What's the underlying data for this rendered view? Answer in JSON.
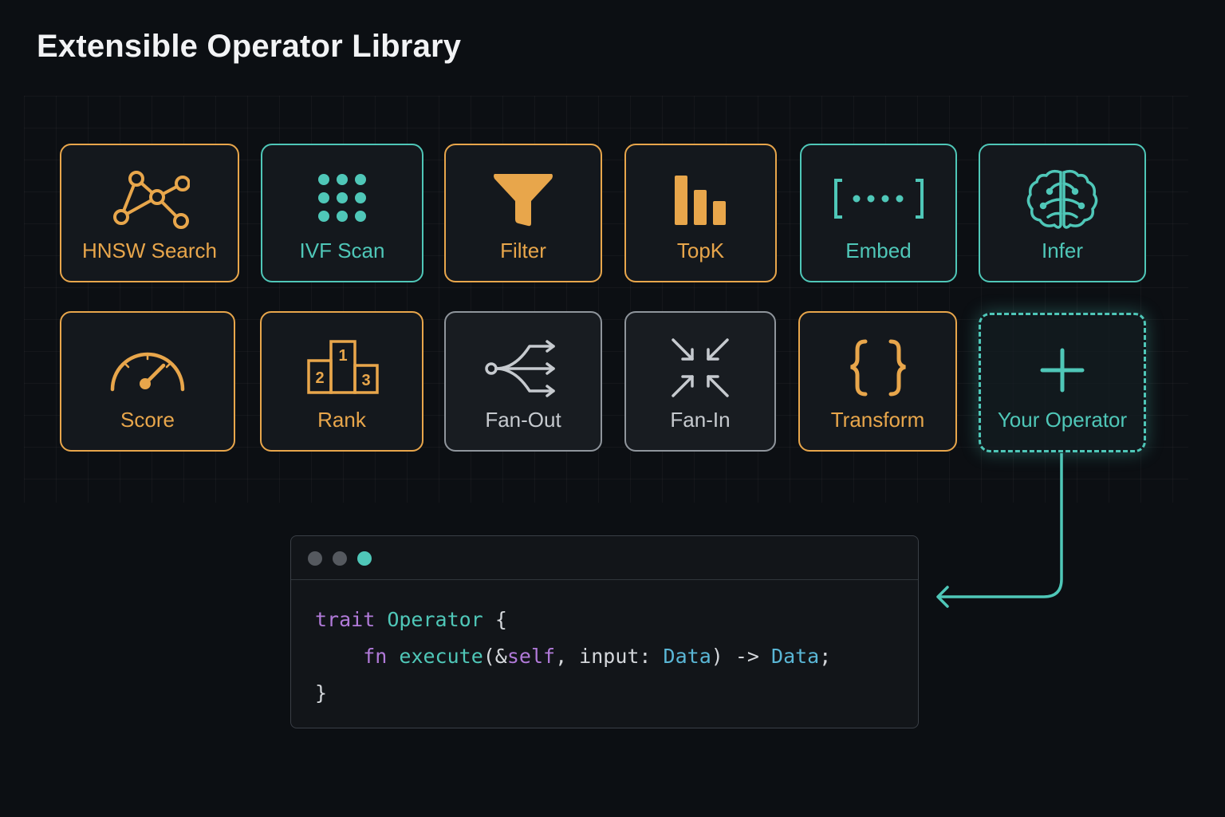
{
  "title": "Extensible Operator Library",
  "colors": {
    "orange": "#e8a64b",
    "teal": "#4fc7b8",
    "gray": "#8f959c",
    "keyword_purple": "#b17ad9",
    "type_blue": "#5ab7d6",
    "background": "#0c0f13"
  },
  "operators": [
    {
      "label": "HNSW Search",
      "icon": "graph-icon",
      "color": "orange"
    },
    {
      "label": "IVF Scan",
      "icon": "dot-grid-icon",
      "color": "teal"
    },
    {
      "label": "Filter",
      "icon": "funnel-icon",
      "color": "orange"
    },
    {
      "label": "TopK",
      "icon": "bar-chart-icon",
      "color": "orange"
    },
    {
      "label": "Embed",
      "icon": "vector-bracket-icon",
      "color": "teal"
    },
    {
      "label": "Infer",
      "icon": "brain-icon",
      "color": "teal"
    },
    {
      "label": "Score",
      "icon": "gauge-icon",
      "color": "orange"
    },
    {
      "label": "Rank",
      "icon": "podium-icon",
      "color": "orange"
    },
    {
      "label": "Fan-Out",
      "icon": "fan-out-icon",
      "color": "gray"
    },
    {
      "label": "Fan-In",
      "icon": "fan-in-icon",
      "color": "gray"
    },
    {
      "label": "Transform",
      "icon": "curly-braces-icon",
      "color": "orange"
    },
    {
      "label": "Your Operator",
      "icon": "plus-icon",
      "color": "teal",
      "style": "dashed"
    }
  ],
  "rank_podium": [
    "1",
    "2",
    "3"
  ],
  "code": {
    "window_dots": [
      "#55595f",
      "#55595f",
      "#4fc7b8"
    ],
    "line1": {
      "keyword": "trait",
      "name": "Operator",
      "open": "{"
    },
    "line2": {
      "keyword": "fn",
      "name": "execute",
      "paren_open": "(&",
      "self": "self",
      "sep": ", input: ",
      "type1": "Data",
      "arrow": ") -> ",
      "type2": "Data",
      "end": ";"
    },
    "line3": {
      "close": "}"
    }
  }
}
